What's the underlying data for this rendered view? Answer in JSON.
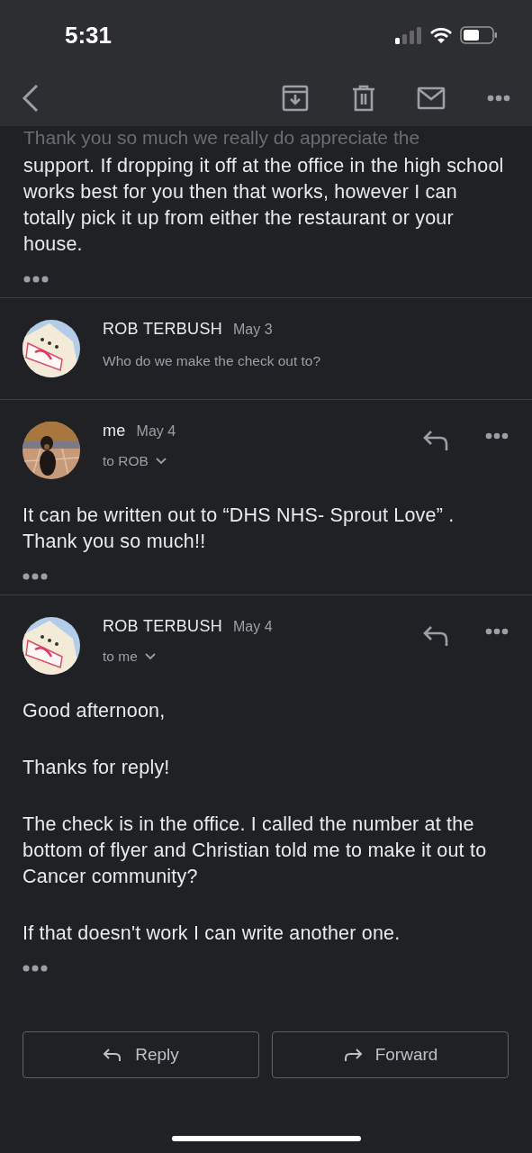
{
  "status_bar": {
    "time": "5:31"
  },
  "faded_line": "Thank you so much we really do appreciate the",
  "messages": [
    {
      "kind": "body",
      "paragraphs": [
        "support. If dropping it off at the office in the high school works best for you then that works, however I can totally pick it up from either the restaurant or your house."
      ]
    },
    {
      "kind": "collapsed",
      "sender": "ROB TERBUSH",
      "date": "May 3",
      "avatar": {
        "kind": "picture"
      },
      "snippet": "Who do we make the check out to?"
    },
    {
      "kind": "expanded",
      "sender": "me",
      "date": "May 4",
      "avatar": {
        "kind": "picture"
      },
      "recipient": "to ROB",
      "paragraphs": [
        "It can be written out to “DHS NHS- Sprout Love” . Thank you so much!!"
      ]
    },
    {
      "kind": "expanded",
      "sender": "ROB TERBUSH",
      "date": "May 4",
      "avatar": {
        "kind": "picture"
      },
      "recipient": "to me",
      "paragraphs": [
        "Good afternoon,",
        "Thanks for reply!",
        "The check is in the office. I called the number at the bottom of flyer and Christian told me to make it out to Cancer community?",
        "If that doesn't work I can write another one."
      ]
    }
  ],
  "actions": [
    {
      "kind": "reply",
      "label": "Reply"
    },
    {
      "kind": "forward",
      "label": "Forward"
    }
  ]
}
